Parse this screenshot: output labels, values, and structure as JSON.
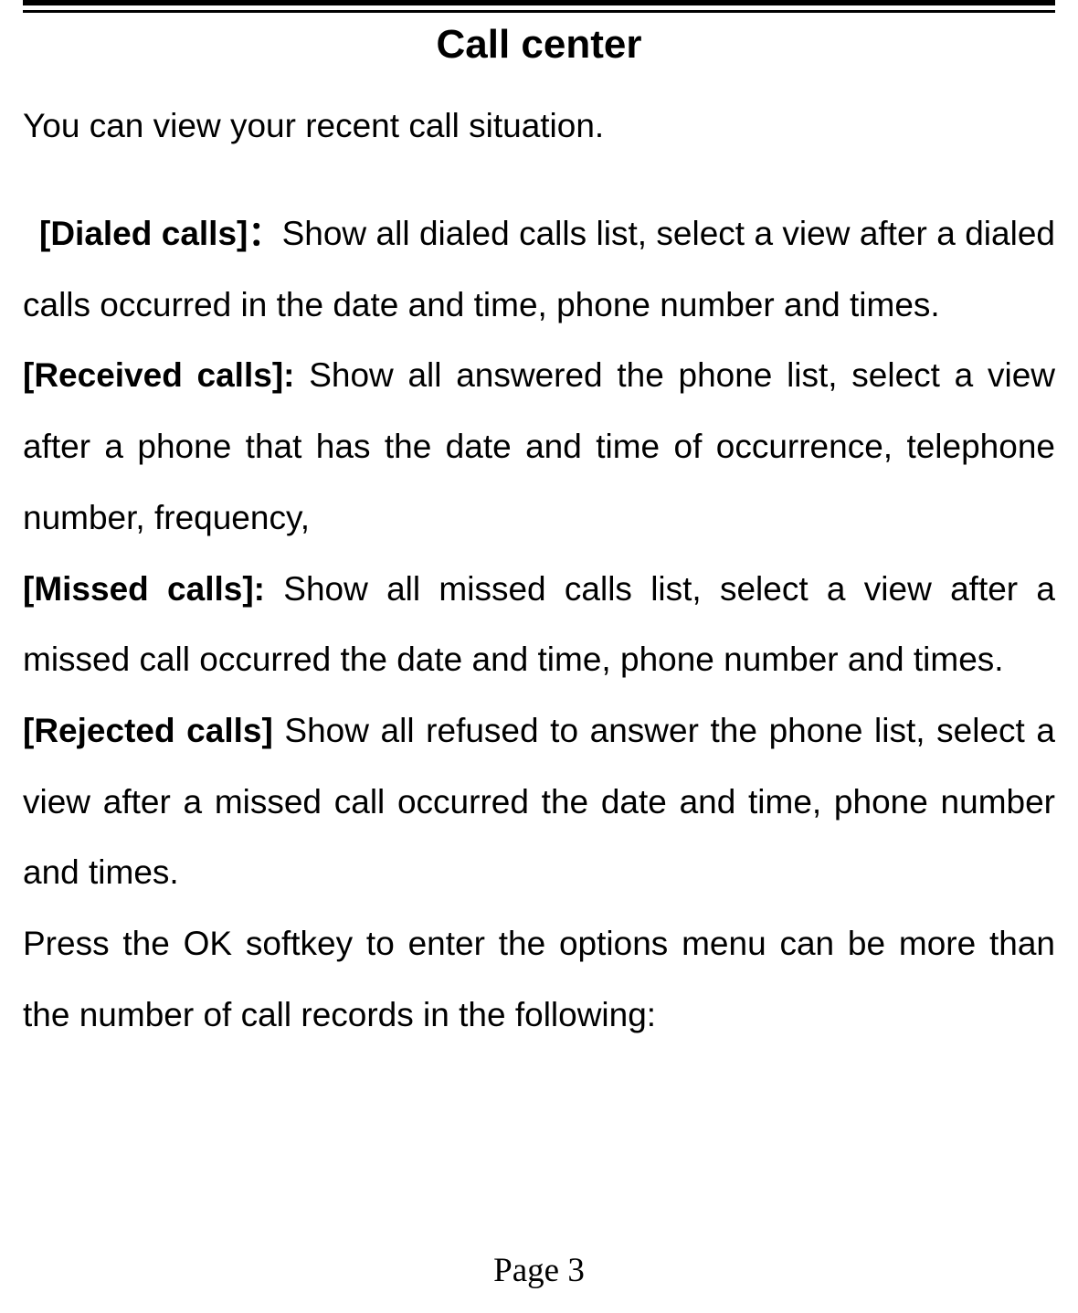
{
  "title": "Call center",
  "intro": "You can view your recent call situation.",
  "sections": [
    {
      "label": "[Dialed calls]：",
      "text": "Show all dialed calls list, select a view after a dialed calls occurred in the date and time, phone number and times.",
      "indent": true
    },
    {
      "label": "[Received calls]: ",
      "text": "Show all answered the phone list, select a view after a phone that has the date and time of occurrence, telephone number, frequency,",
      "indent": false
    },
    {
      "label": "[Missed calls]: ",
      "text": "Show all missed calls list, select a view after a missed call occurred the date and time, phone number and times.",
      "indent": false
    },
    {
      "label": "[Rejected calls] ",
      "text": "Show all refused to answer the phone list, select a view after a missed call occurred the date and time, phone number and times.",
      "indent": false
    }
  ],
  "closing": "Press the OK softkey to enter the options menu can be more than the number of call records in the following:",
  "footer": "Page 3"
}
